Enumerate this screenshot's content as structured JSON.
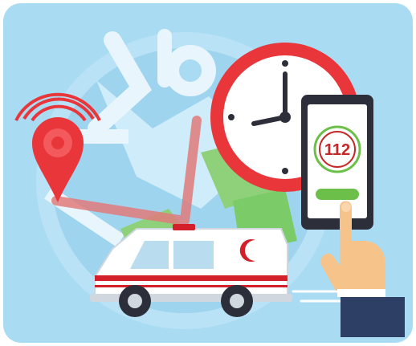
{
  "phone": {
    "emergency_number": "112"
  },
  "colors": {
    "background": "#a9dbf3",
    "map_land": "#e8f5fc",
    "map_park": "#8fd17a",
    "route": "#e07a7a",
    "pin": "#e8363b",
    "clock_rim": "#e8363b",
    "phone_body": "#2c2f3a",
    "call_button": "#6cc04a",
    "ambulance_stripe": "#d3202a",
    "skin": "#f6c48a",
    "sleeve": "#2e3f66"
  },
  "icons": [
    "location-pin-icon",
    "clock-icon",
    "smartphone-icon",
    "ambulance-icon",
    "pointing-hand-icon",
    "map-icon"
  ]
}
